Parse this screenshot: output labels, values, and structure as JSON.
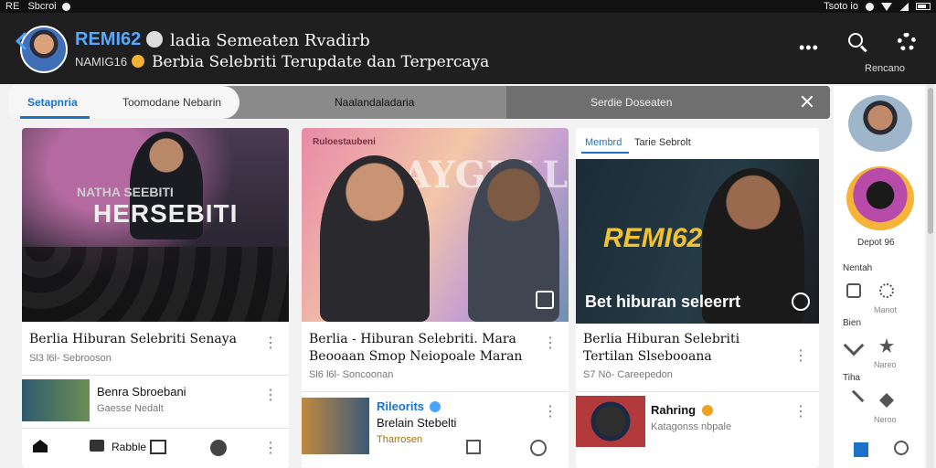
{
  "status_bar": {
    "left_text": "RE   Sbcroi",
    "time": "Tsoto io"
  },
  "header": {
    "channel_name": "REMI62",
    "channel_tag": "ladia Semeaten Rvadirb",
    "handle": "NAMIG16",
    "description": "Berbia Selebriti Terupdate dan Terpercaya",
    "gear_label": "Rencano",
    "more_label": "•••"
  },
  "tabs": {
    "active": "Setapnria",
    "second": "Toomodane Nebarin",
    "third": "Naalandaladaria",
    "fourth": "Serdie Doseaten"
  },
  "cards": [
    {
      "thumb_title_small": "NATHA SEEBITI",
      "thumb_title_big": "HERSEBITI",
      "title": "Berlia Hiburan Selebriti Senaya",
      "meta": "Sl3 l6l- Sebrooson",
      "mini_title": "Benra Sbroebani",
      "mini_sub": "Gaesse Nedalt",
      "bottom_label": "Rabble"
    },
    {
      "thumb_title_small": "Ruloestaubeni",
      "thumb_title_big": "AYGRLL",
      "title": "Berlia - Hiburan Selebriti. Mara Beooaan Smop Neiopoale Maran",
      "meta": "Sl6 l6l- Soncoonan",
      "mini_title": "Rileorits",
      "mini_title_2": "Brelain Stebelti",
      "mini_sub": "Tharrosen"
    },
    {
      "head_tab_1": "Membrd",
      "head_tab_2": "Tarie Sebrolt",
      "thumb_title_big": "REMI62",
      "thumb_title_banner": "Bet hiburan seleerrt",
      "title": "Berlia Hiburan Selebriti Tertilan Slsebooana",
      "meta": "S7 Nö- Careepedon",
      "mini_title": "Rahring",
      "mini_sub": "Katagonss nbpale"
    }
  ],
  "rail": {
    "label_1": "Depot 96",
    "label_2": "Nentah",
    "label_3": "Bien",
    "label_4": "Tiha",
    "sub_1": "Manot",
    "sub_2": "Nareo",
    "sub_3": "Neroo"
  }
}
